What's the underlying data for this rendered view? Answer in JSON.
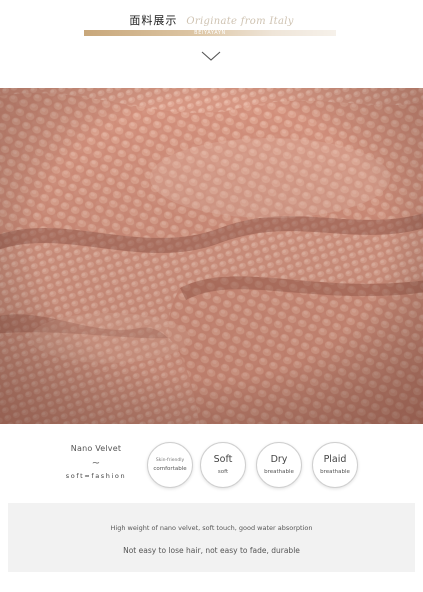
{
  "header": {
    "title_cn": "面料展示",
    "title_script": "Originate from Italy",
    "brand": "BEIYAYAYN"
  },
  "hero": {
    "alt": "pink waffle-knit velvet fabric close-up",
    "colors": {
      "light": "#e7b7a5",
      "base": "#d89884",
      "shadow": "#b67564"
    }
  },
  "features": {
    "nano_title": "Nano Velvet",
    "nano_tilde": "~",
    "nano_sub": "soft≈fashion",
    "badges": [
      {
        "title": "Skin-friendly",
        "sub": "comfortable",
        "style": "small"
      },
      {
        "title": "Soft",
        "sub": "soft",
        "style": "normal"
      },
      {
        "title": "Dry",
        "sub": "breathable",
        "style": "normal"
      },
      {
        "title": "Plaid",
        "sub": "breathable",
        "style": "normal"
      }
    ]
  },
  "description": {
    "line1": "High weight of nano velvet, soft touch, good water absorption",
    "line2": "Not easy to lose hair, not easy to fade, durable"
  }
}
